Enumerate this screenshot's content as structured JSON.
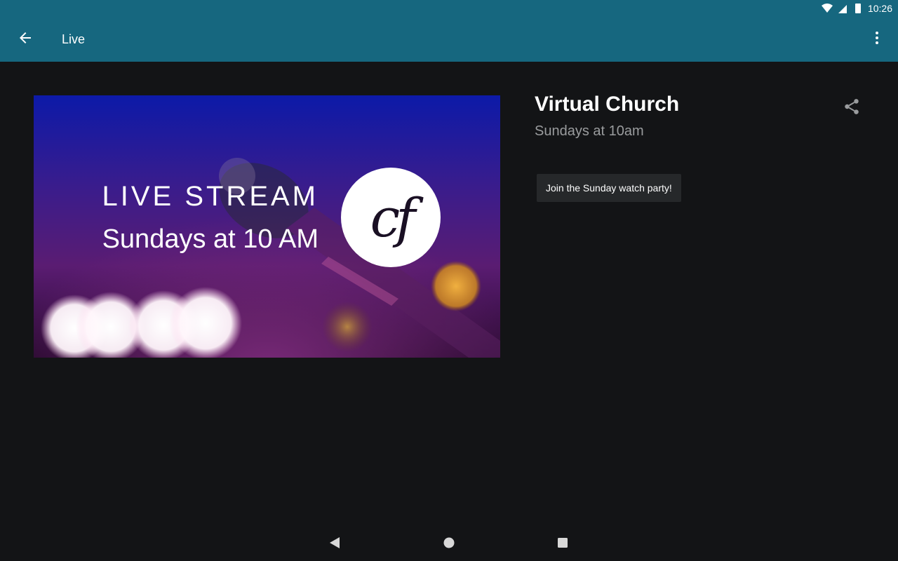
{
  "status_bar": {
    "time": "10:26",
    "icons": [
      "wifi-icon",
      "signal-icon",
      "battery-icon"
    ]
  },
  "app_bar": {
    "title": "Live",
    "back_icon": "arrow-back-icon",
    "menu_icon": "more-vert-icon"
  },
  "hero_image": {
    "headline": "LIVE STREAM",
    "subline": "Sundays at 10 AM",
    "logo_text": "cf"
  },
  "event": {
    "name": "Virtual Church",
    "schedule": "Sundays at 10am",
    "share_icon": "share-icon",
    "action_label": "Join the Sunday watch party!"
  },
  "nav_bar": {
    "icons": [
      "back-triangle-icon",
      "home-circle-icon",
      "recents-square-icon"
    ]
  },
  "colors": {
    "app_bar": "#16677f",
    "background": "#131416",
    "chip": "#26282a",
    "secondary_text": "#9a9c9e"
  }
}
